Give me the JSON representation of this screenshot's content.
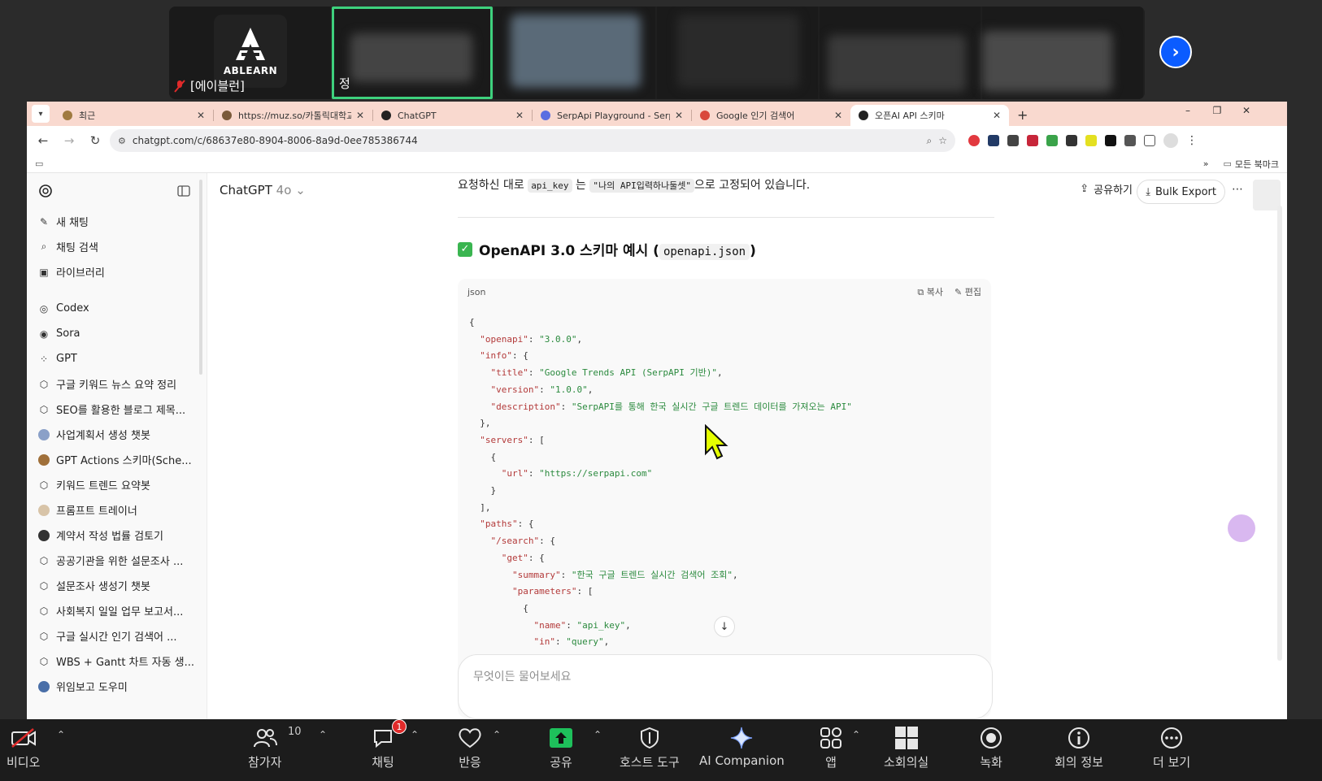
{
  "zoom_top": {
    "tile0_name": "[에이블런]",
    "logo_text": "ABLEARN",
    "tile1_name_initial": "정"
  },
  "browser": {
    "tabs": [
      {
        "title": "최근",
        "fav_color": "#a07a40"
      },
      {
        "title": "https://muz.so/카톨릭대학교",
        "fav_color": "#7a5a3a"
      },
      {
        "title": "ChatGPT",
        "fav_color": "#222222"
      },
      {
        "title": "SerpApi Playground - SerpApi",
        "fav_color": "#5b6ee1"
      },
      {
        "title": "Google 인기 검색어",
        "fav_color": "#d9483b"
      },
      {
        "title": "오픈AI API 스키마",
        "fav_color": "#222222",
        "active": true
      }
    ],
    "new_tab": "+",
    "url": "chatgpt.com/c/68637e80-8904-8006-8a9d-0ee785386744",
    "bookmarks_more": "»",
    "all_bookmarks": "모든 북마크"
  },
  "sidebar": {
    "top_items": [
      "새 채팅",
      "채팅 검색",
      "라이브러리"
    ],
    "mid_items": [
      "Codex",
      "Sora",
      "GPT"
    ],
    "gpt_items": [
      "구글 키워드 뉴스 요약 정리",
      "SEO를 활용한 블로그 제목...",
      "사업계획서 생성 챗봇",
      "GPT Actions 스키마(Sche...",
      "키워드 트렌드 요약봇",
      "프롬프트 트레이너",
      "계약서 작성 법률 검토기",
      "공공기관을 위한 설문조사 ...",
      "설문조사 생성기 챗봇",
      "사회복지 일일 업무 보고서...",
      "구글 실시간 인기 검색어 ...",
      "WBS + Gantt 차트 자동 생...",
      "위임보고 도우미"
    ]
  },
  "header": {
    "model": "ChatGPT",
    "model_version": "4o",
    "share": "공유하기",
    "bulk_export": "Bulk Export"
  },
  "conversation": {
    "intro_prefix": "요청하신 대로",
    "intro_code1": "api_key",
    "intro_mid": "는",
    "intro_code2": "\"나의 API입력하나둘셋\"",
    "intro_suffix": "으로 고정되어 있습니다.",
    "heading": "OpenAPI 3.0 스키마 예시 (",
    "heading_code": "openapi.json",
    "heading_close": ")",
    "code_lang": "json",
    "copy": "복사",
    "edit": "편집"
  },
  "code_lines": [
    "{",
    "  \"openapi\": \"3.0.0\",",
    "  \"info\": {",
    "    \"title\": \"Google Trends API (SerpAPI 기반)\",",
    "    \"version\": \"1.0.0\",",
    "    \"description\": \"SerpAPI를 통해 한국 실시간 구글 트렌드 데이터를 가져오는 API\"",
    "  },",
    "  \"servers\": [",
    "    {",
    "      \"url\": \"https://serpapi.com\"",
    "    }",
    "  ],",
    "  \"paths\": {",
    "    \"/search\": {",
    "      \"get\": {",
    "        \"summary\": \"한국 구글 트렌드 실시간 검색어 조회\",",
    "        \"parameters\": [",
    "          {",
    "            \"name\": \"api_key\",",
    "            \"in\": \"query\","
  ],
  "composer": {
    "placeholder": "무엇이든 물어보세요"
  },
  "zoom_bar": {
    "video": "비디오",
    "participants": "참가자",
    "participants_count": "10",
    "chat": "채팅",
    "chat_badge": "1",
    "reactions": "반응",
    "share": "공유",
    "host_tools": "호스트 도구",
    "ai_companion": "AI Companion",
    "apps": "앱",
    "breakout": "소회의실",
    "record": "녹화",
    "meeting_info": "회의 정보",
    "more": "더 보기"
  },
  "colors": {
    "tab_strip": "#f9d9cf",
    "zoom_active_border": "#3ed17d",
    "share_green": "#1ec05b",
    "zoom_blue": "#0b5cff"
  }
}
